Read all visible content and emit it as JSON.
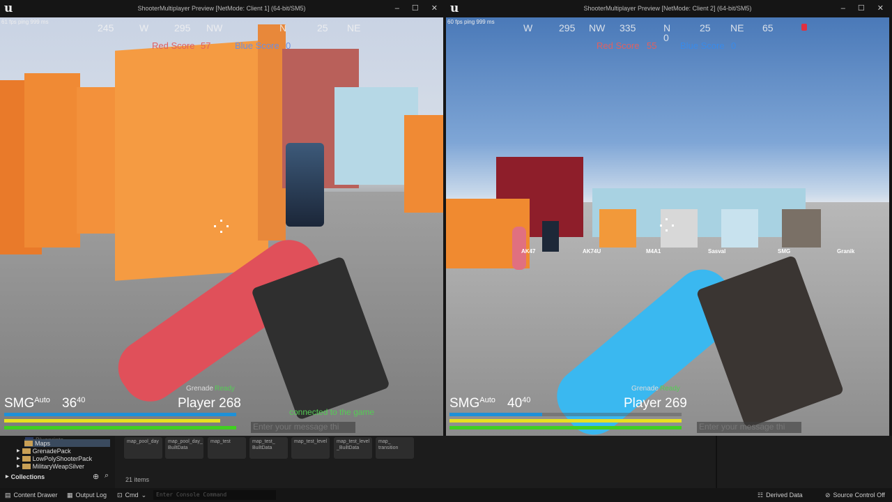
{
  "client1": {
    "title": "ShooterMultiplayer Preview [NetMode: Client 1]  (64-bit/SM5)",
    "fps": "61 fps ping 999 ms",
    "compass": [
      "245",
      "W",
      "295",
      "NW",
      "N",
      "25",
      "NE"
    ],
    "red_score_label": "Red Score",
    "red_score": "57",
    "blue_score_label": "Blue Score",
    "blue_score": "0",
    "weapon": "SMG",
    "fire_mode": "Auto",
    "ammo": "36",
    "ammo_max": "40",
    "grenade_label": "Grenade",
    "grenade_status": "Ready",
    "player": "Player 268",
    "chat_message": "connected to the game",
    "chat_placeholder": "Enter your message thi",
    "bars": {
      "shield": 1.0,
      "stamina": 0.93,
      "health": 1.0
    }
  },
  "client2": {
    "title": "ShooterMultiplayer Preview [NetMode: Client 2]  (64-bit/SM5)",
    "fps": "60 fps ping 999 ms",
    "compass": [
      "W",
      "295",
      "NW",
      "335",
      "N",
      "0",
      "25",
      "NE",
      "65"
    ],
    "red_score_label": "Red Score",
    "red_score": "55",
    "blue_score_label": "Blue Score",
    "blue_score": "0",
    "weapon": "SMG",
    "fire_mode": "Auto",
    "ammo": "40",
    "ammo_max": "40",
    "grenade_label": "Grenade",
    "grenade_status": "Ready",
    "player": "Player 269",
    "chat_placeholder": "Enter your message thi",
    "weapon_labels": [
      "AK47",
      "AK74U",
      "M4A1",
      "Sasval",
      "SMG",
      "Granik"
    ],
    "bars": {
      "shield": 0.4,
      "stamina": 1.0,
      "health": 1.0
    }
  },
  "content_browser": {
    "tree": [
      "Blueprints",
      "Maps",
      "GrenadePack",
      "LowPolyShooterPack",
      "MilitaryWeapSilver"
    ],
    "collections": "Collections",
    "assets": [
      "map_pool_day",
      "map_pool_day_ BuiltData",
      "map_test",
      "map_test_ BuiltData",
      "map_test_level",
      "map_test_level _BuiltData",
      "map_ transition"
    ],
    "item_count": "21 items"
  },
  "statusbar": {
    "content_drawer": "Content Drawer",
    "output_log": "Output Log",
    "cmd": "Cmd",
    "console_placeholder": "Enter Console Command",
    "derived_data": "Derived Data",
    "source_control": "Source Control Off"
  }
}
